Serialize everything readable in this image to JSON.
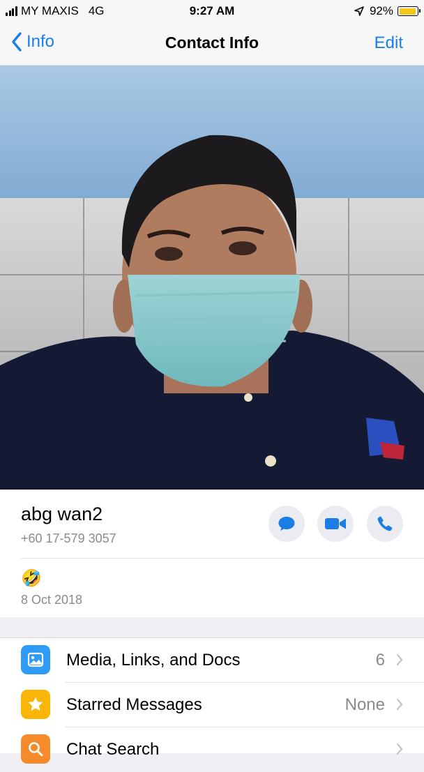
{
  "status_bar": {
    "carrier": "MY MAXIS",
    "network": "4G",
    "time": "9:27 AM",
    "battery_text": "92%",
    "battery_level": 0.92
  },
  "nav": {
    "back_label": "Info",
    "title": "Contact Info",
    "edit_label": "Edit"
  },
  "contact": {
    "name": "abg wan2",
    "phone": "+60 17-579 3057",
    "about_emoji": "🤣",
    "about_date": "8 Oct 2018",
    "actions": [
      "message-icon",
      "video-call-icon",
      "phone-icon"
    ]
  },
  "menu": {
    "items": [
      {
        "label": "Media, Links, and Docs",
        "value": "6",
        "icon": "photo-icon",
        "color": "#2f9bf5"
      },
      {
        "label": "Starred Messages",
        "value": "None",
        "icon": "star-icon",
        "color": "#f9b609"
      },
      {
        "label": "Chat Search",
        "value": "",
        "icon": "search-icon",
        "color": "#f58b2a"
      }
    ]
  },
  "colors": {
    "accent": "#1a7ee6",
    "background": "#efeff4"
  }
}
